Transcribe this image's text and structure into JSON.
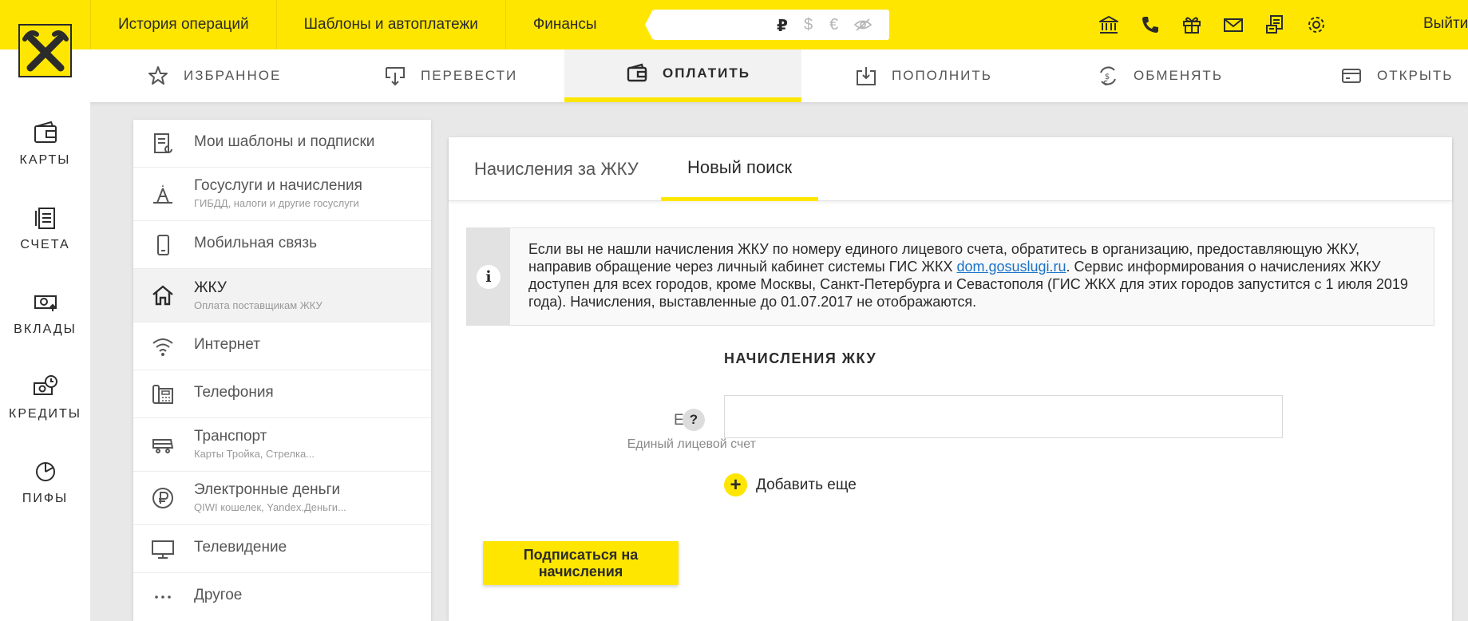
{
  "topnav": {
    "items": [
      "История операций",
      "Шаблоны и автоплатежи",
      "Финансы"
    ],
    "currencies": {
      "rub": "₽",
      "usd": "$",
      "eur": "€"
    },
    "logout": "Выйти"
  },
  "subnav": {
    "favorites": "ИЗБРАННОЕ",
    "transfer": "ПЕРЕВЕСТИ",
    "pay": "ОПЛАТИТЬ",
    "topup": "ПОПОЛНИТЬ",
    "exchange": "ОБМЕНЯТЬ",
    "open": "ОТКРЫТЬ"
  },
  "rail": {
    "cards": "КАРТЫ",
    "accounts": "СЧЕТА",
    "deposits": "ВКЛАДЫ",
    "credits": "КРЕДИТЫ",
    "funds": "ПИФЫ"
  },
  "categories": [
    {
      "title": "Мои шаблоны и подписки",
      "sub": ""
    },
    {
      "title": "Госуслуги и начисления",
      "sub": "ГИБДД, налоги и другие госуслуги"
    },
    {
      "title": "Мобильная связь",
      "sub": ""
    },
    {
      "title": "ЖКУ",
      "sub": "Оплата поставщикам ЖКУ"
    },
    {
      "title": "Интернет",
      "sub": ""
    },
    {
      "title": "Телефония",
      "sub": ""
    },
    {
      "title": "Транспорт",
      "sub": "Карты Тройка, Стрелка..."
    },
    {
      "title": "Электронные деньги",
      "sub": "QIWI кошелек, Yandex.Деньги..."
    },
    {
      "title": "Телевидение",
      "sub": ""
    },
    {
      "title": "Другое",
      "sub": ""
    }
  ],
  "main": {
    "tabs": [
      "Начисления за ЖКУ",
      "Новый поиск"
    ],
    "info": {
      "text1": "Если вы не нашли начисления ЖКУ по номеру единого лицевого счета, обратитесь в организацию, предоставляющую ЖКУ, направив обращение через личный кабинет системы ГИС ЖКХ ",
      "link": "dom.gosuslugi.ru",
      "text2": ". Сервис информирования о начислениях ЖКУ доступен для всех городов, кроме Москвы, Санкт-Петербурга и Севастополя (ГИС ЖКХ для этих городов запустится с 1 июля 2019 года). Начисления, выставленные до 01.07.2017 не отображаются."
    },
    "section_title": "НАЧИСЛЕНИЯ ЖКУ",
    "field_label": "ЕЛС",
    "field_hint": "?",
    "field_sub": "Единый лицевой счет",
    "field_value": "",
    "add_more": "Добавить еще",
    "subscribe": "Подписаться на начисления"
  },
  "colors": {
    "accent": "#fee600",
    "text": "#2b2b2b",
    "link": "#1a73c8"
  }
}
